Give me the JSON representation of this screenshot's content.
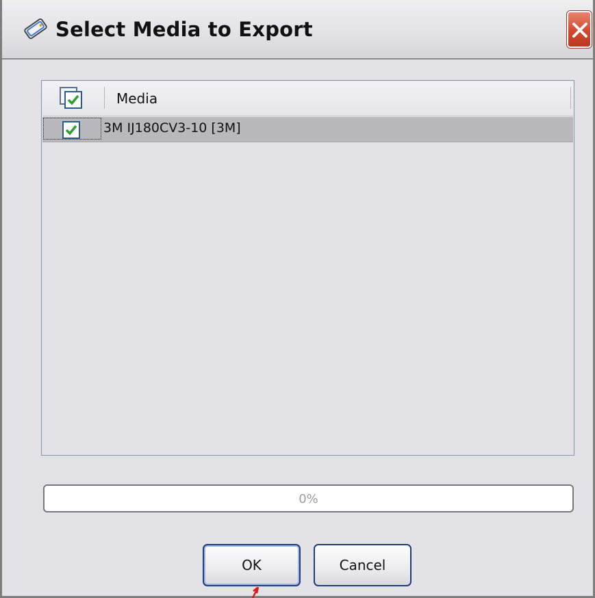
{
  "window": {
    "title": "Select Media to Export"
  },
  "list": {
    "columns": [
      "Media"
    ],
    "header_all_checked": true,
    "rows": [
      {
        "checked": true,
        "label": "3M IJ180CV3-10 [3M]",
        "selected": true
      }
    ]
  },
  "progress": {
    "value": 0,
    "text": "0%"
  },
  "buttons": {
    "ok": "OK",
    "cancel": "Cancel"
  },
  "colors": {
    "check": "#2e9e2e",
    "close_button": "#d2482c",
    "button_border": "#1d3c7a"
  },
  "icons": {
    "title": "media-tag-icon",
    "close": "close-icon",
    "header_check": "select-all-checkbox-icon",
    "row_check": "checkbox-checked-icon"
  }
}
